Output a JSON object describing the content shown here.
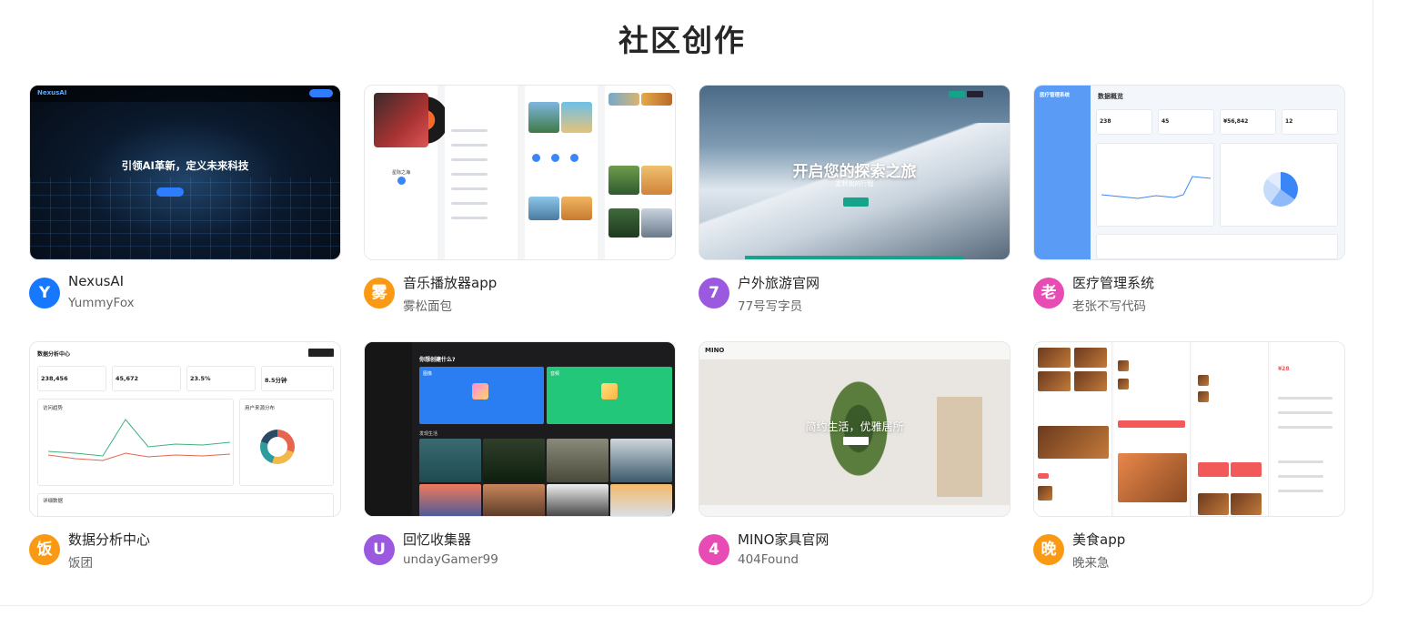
{
  "section_title": "社区创作",
  "cards": [
    {
      "title": "NexusAI",
      "author": "YummyFox",
      "avatar_char": "Y",
      "avatar_color": "#1677ff",
      "thumb": {
        "logo": "NexusAI",
        "headline": "引领AI革新，定义未来科技"
      }
    },
    {
      "title": "音乐播放器app",
      "author": "雾松面包",
      "avatar_char": "雾",
      "avatar_color": "#fa9a14",
      "thumb": {
        "song": "星际之海"
      }
    },
    {
      "title": "户外旅游官网",
      "author": "77号写字员",
      "avatar_char": "7",
      "avatar_color": "#9b59e0",
      "thumb": {
        "headline": "开启您的探索之旅",
        "sub": "定制我的行程"
      }
    },
    {
      "title": "医疗管理系统",
      "author": "老张不写代码",
      "avatar_char": "老",
      "avatar_color": "#e84bb3",
      "thumb": {
        "side_title": "医疗管理系统",
        "header": "数据概览",
        "stats": [
          "238",
          "45",
          "¥56,842",
          "12"
        ]
      }
    },
    {
      "title": "数据分析中心",
      "author": "饭团",
      "avatar_char": "饭",
      "avatar_color": "#fa9a14",
      "thumb": {
        "header": "数据分析中心",
        "stats": [
          "238,456",
          "45,672",
          "23.5%",
          "8.5分钟"
        ],
        "chart1": "访问趋势",
        "chart2": "用户来源分布",
        "table": "详细数据"
      }
    },
    {
      "title": "回忆收集器",
      "author": "undayGamer99",
      "avatar_char": "U",
      "avatar_color": "#9b59e0",
      "thumb": {
        "question": "你想创建什么?",
        "tile1": "图像",
        "tile2": "音频",
        "section": "发现生活"
      }
    },
    {
      "title": "MINO家具官网",
      "author": "404Found",
      "avatar_char": "4",
      "avatar_color": "#e84bb3",
      "thumb": {
        "logo": "MINO",
        "headline": "简约生活，优雅居所"
      }
    },
    {
      "title": "美食app",
      "author": "晚来急",
      "avatar_char": "晚",
      "avatar_color": "#fa9a14",
      "thumb": {
        "price": "¥28"
      }
    }
  ]
}
